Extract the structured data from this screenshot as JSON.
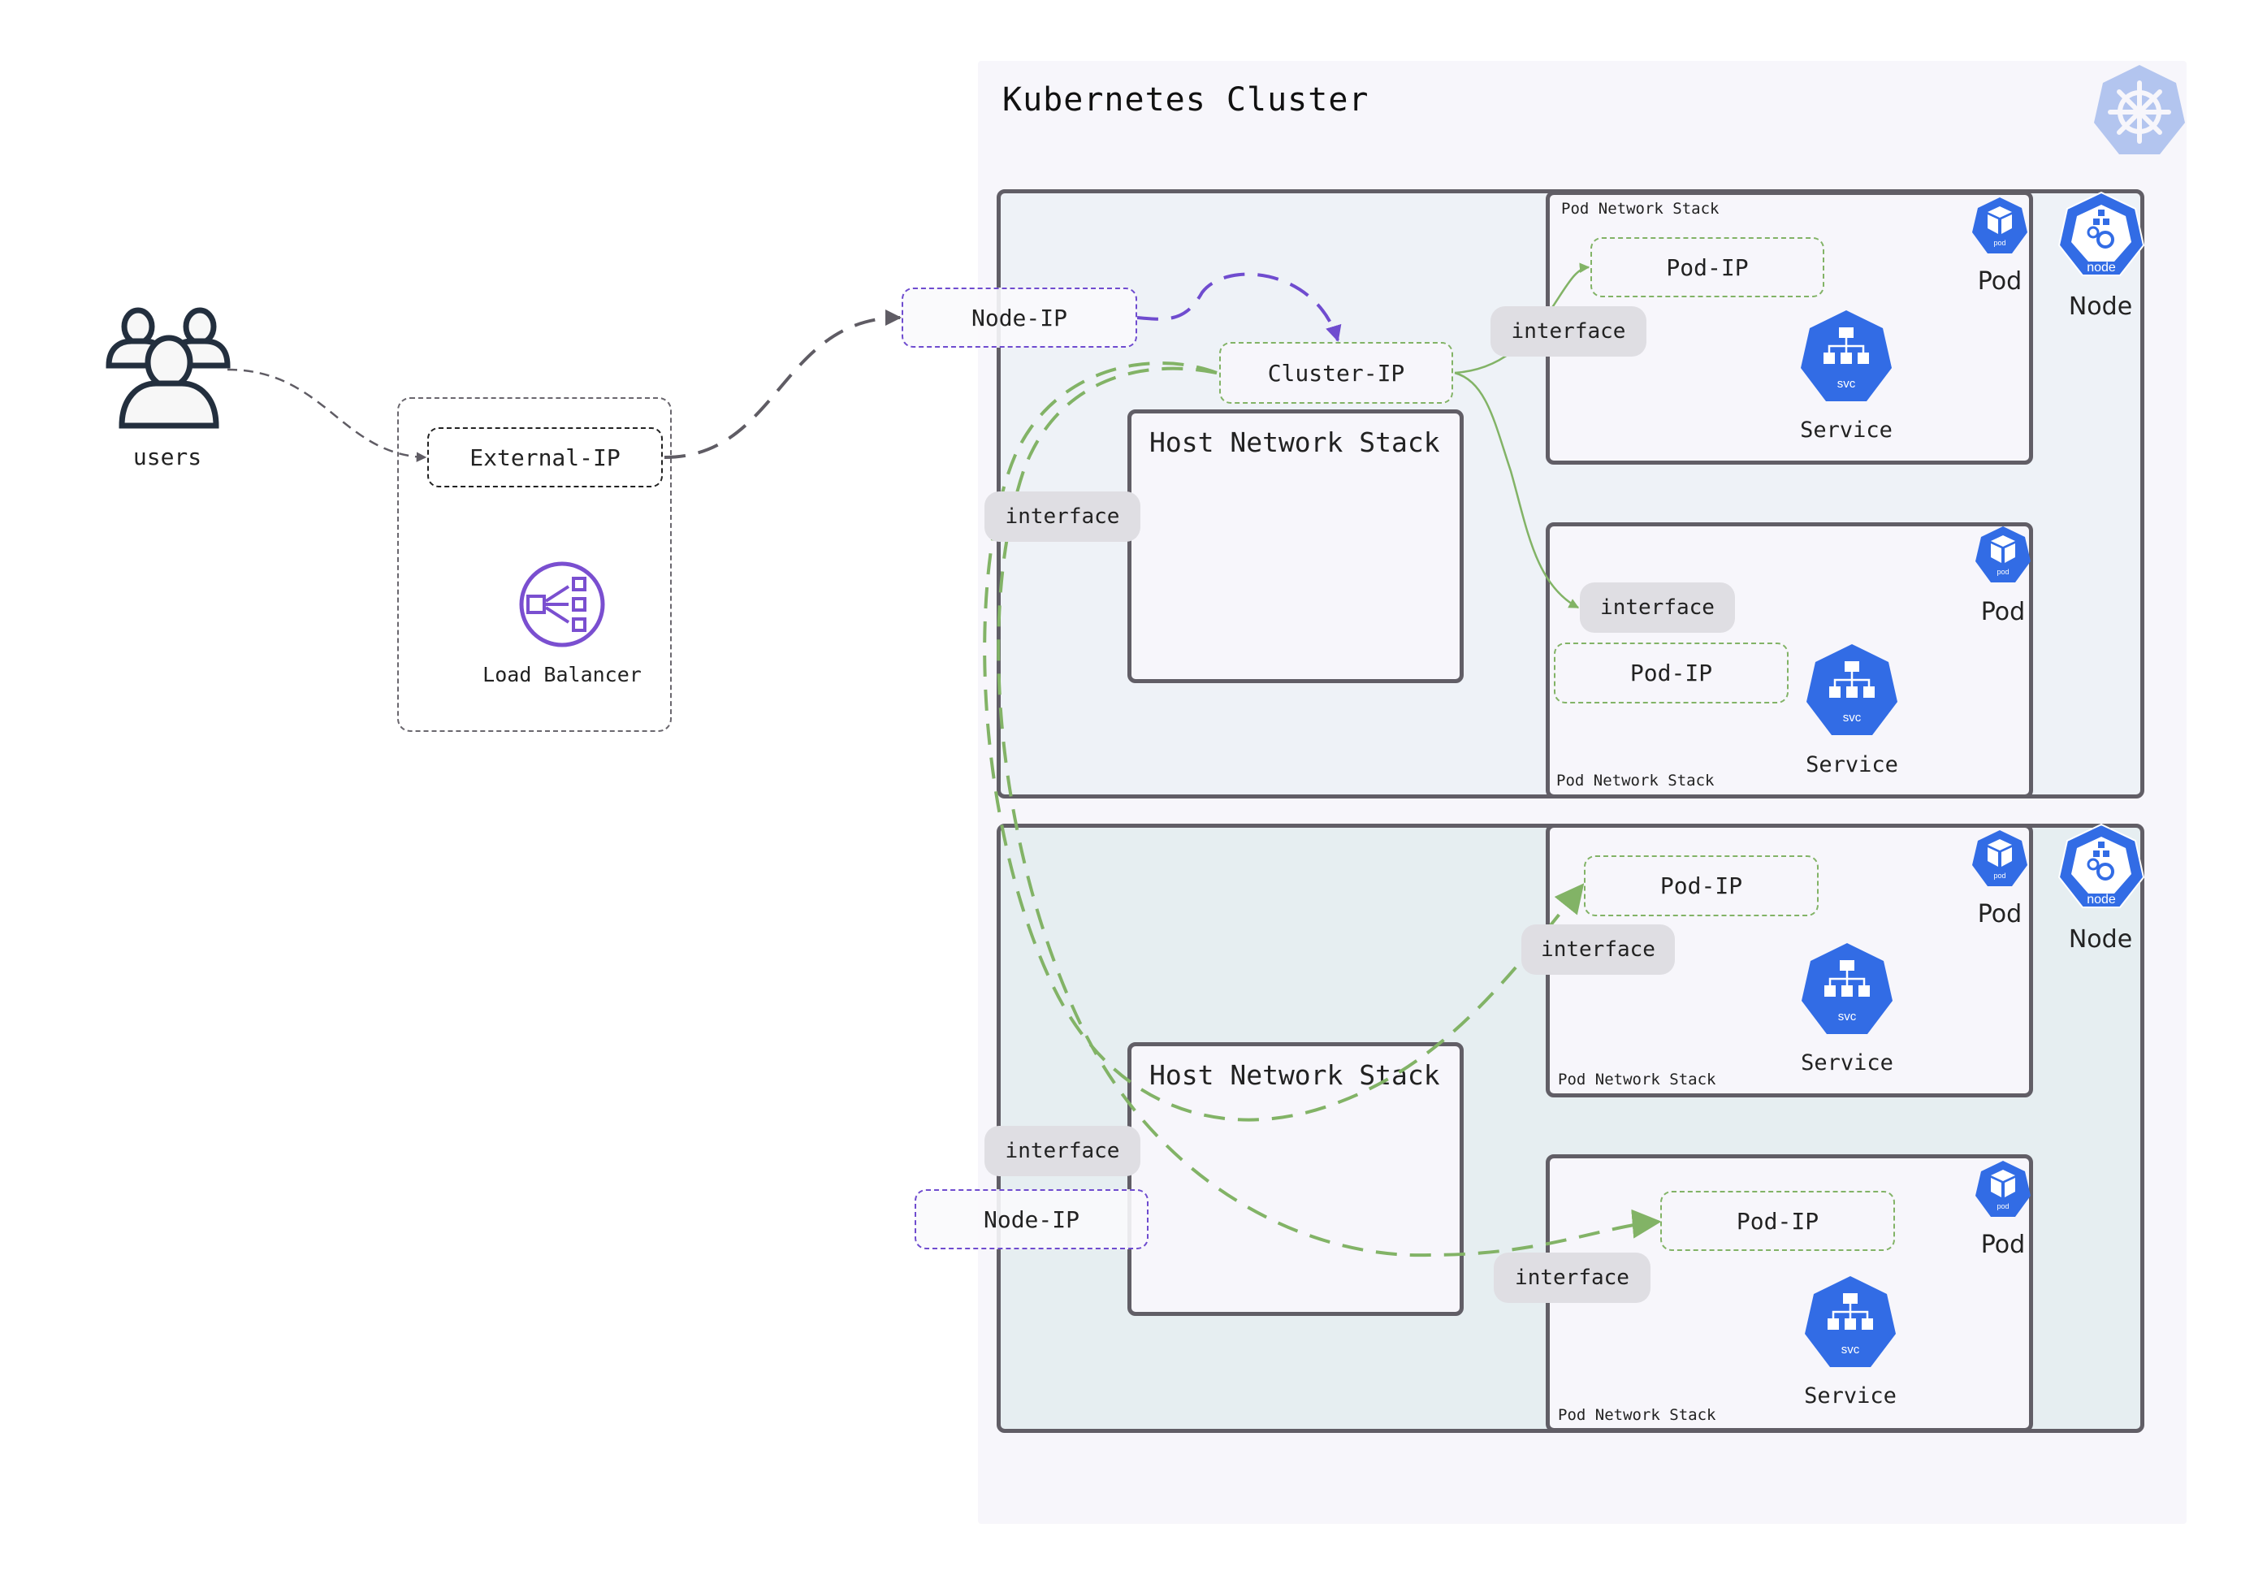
{
  "cluster": {
    "title": "Kubernetes Cluster",
    "logo_icon": "kubernetes-helm-icon"
  },
  "external": {
    "users_label": "users",
    "external_ip_label": "External-IP",
    "load_balancer_label": "Load Balancer"
  },
  "nodes": [
    {
      "label": "Node",
      "icon_text": "node",
      "node_ip_label": "Node-IP",
      "host_stack_label": "Host Network Stack",
      "interface_label": "interface",
      "pods": [
        {
          "pod_label": "Pod",
          "pod_icon_text": "pod",
          "stack_label": "Pod Network Stack",
          "pod_ip_label": "Pod-IP",
          "interface_label": "interface",
          "service_label": "Service",
          "service_icon_text": "svc"
        },
        {
          "pod_label": "Pod",
          "pod_icon_text": "pod",
          "stack_label": "Pod Network Stack",
          "pod_ip_label": "Pod-IP",
          "interface_label": "interface",
          "service_label": "Service",
          "service_icon_text": "svc"
        }
      ]
    },
    {
      "label": "Node",
      "icon_text": "node",
      "node_ip_label": "Node-IP",
      "host_stack_label": "Host Network Stack",
      "interface_label": "interface",
      "pods": [
        {
          "pod_label": "Pod",
          "pod_icon_text": "pod",
          "stack_label": "Pod Network Stack",
          "pod_ip_label": "Pod-IP",
          "interface_label": "interface",
          "service_label": "Service",
          "service_icon_text": "svc"
        },
        {
          "pod_label": "Pod",
          "pod_icon_text": "pod",
          "stack_label": "Pod Network Stack",
          "pod_ip_label": "Pod-IP",
          "interface_label": "interface",
          "service_label": "Service",
          "service_icon_text": "svc"
        }
      ]
    }
  ],
  "cluster_ip_label": "Cluster-IP",
  "colors": {
    "k8s_blue": "#326ce5",
    "k8s_logo_light": "#b3c5ef",
    "green_flow": "#82b366",
    "purple_flow": "#6f4ccf",
    "gray_flow": "#5f5c64",
    "border_dark": "#615e66",
    "interface_bg": "#dfdee3"
  }
}
